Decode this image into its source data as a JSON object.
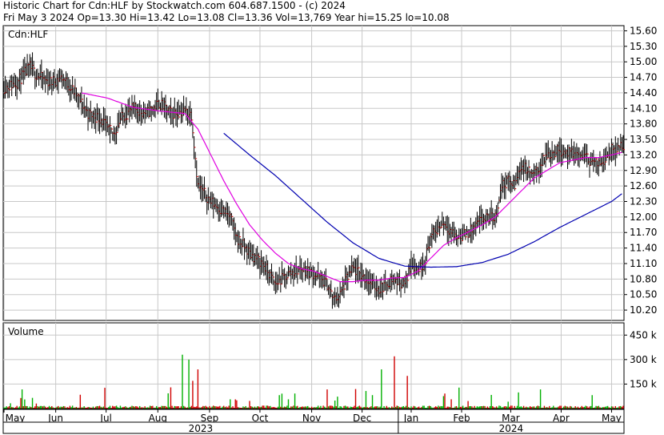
{
  "header": {
    "line1": "Historic Chart for Cdn:HLF by Stockwatch.com 604.687.1500 - (c) 2024",
    "line2": "Fri May  3 2024   Op=13.30   Hi=13.42   Lo=13.08   Cl=13.36   Vol=13,769   Year hi=15.25   lo=10.08"
  },
  "symbol_label": "Cdn:HLF",
  "volume_label": "Volume",
  "colors": {
    "candle": "#000000",
    "close_tick": "#cc0000",
    "ma_short": "#e000e0",
    "ma_long": "#0000b0",
    "vol_up": "#00b000",
    "vol_down": "#d00000",
    "grid": "#c8c8c8",
    "frame": "#000000"
  },
  "chart_data": [
    {
      "type": "line",
      "title": "Cdn:HLF",
      "ylim": [
        10.0,
        15.7
      ],
      "y_ticks": [
        "15.60",
        "15.30",
        "15.00",
        "14.70",
        "14.40",
        "14.10",
        "13.80",
        "13.50",
        "13.20",
        "12.90",
        "12.60",
        "12.30",
        "12.00",
        "11.70",
        "11.40",
        "11.10",
        "10.80",
        "10.50",
        "10.20"
      ],
      "x_ticks": [
        "May",
        "Jun",
        "Jul",
        "Aug",
        "Sep",
        "Oct",
        "Nov",
        "Dec",
        "Jan",
        "Feb",
        "Mar",
        "Apr",
        "May"
      ],
      "year_labels": [
        "2023",
        "2024"
      ],
      "grid": true,
      "series": [
        {
          "name": "price_close",
          "anchors": [
            [
              0,
              14.5
            ],
            [
              10,
              14.6
            ],
            [
              20,
              14.9
            ],
            [
              25,
              14.75
            ],
            [
              35,
              14.6
            ],
            [
              45,
              14.7
            ],
            [
              55,
              14.4
            ],
            [
              65,
              14.0
            ],
            [
              75,
              13.9
            ],
            [
              80,
              13.7
            ],
            [
              85,
              13.6
            ],
            [
              90,
              13.9
            ],
            [
              100,
              14.1
            ],
            [
              110,
              14.0
            ],
            [
              120,
              14.2
            ],
            [
              130,
              14.0
            ],
            [
              140,
              14.05
            ],
            [
              145,
              13.98
            ],
            [
              150,
              12.6
            ],
            [
              160,
              12.3
            ],
            [
              170,
              12.1
            ],
            [
              175,
              12.0
            ],
            [
              180,
              11.6
            ],
            [
              190,
              11.3
            ],
            [
              200,
              11.1
            ],
            [
              210,
              10.7
            ],
            [
              220,
              10.9
            ],
            [
              230,
              11.0
            ],
            [
              240,
              10.9
            ],
            [
              250,
              10.7
            ],
            [
              255,
              10.4
            ],
            [
              260,
              10.5
            ],
            [
              265,
              10.8
            ],
            [
              270,
              11.0
            ],
            [
              280,
              10.8
            ],
            [
              290,
              10.6
            ],
            [
              300,
              10.8
            ],
            [
              310,
              10.7
            ],
            [
              315,
              11.1
            ],
            [
              320,
              11.0
            ],
            [
              325,
              11.1
            ],
            [
              330,
              11.6
            ],
            [
              340,
              11.9
            ],
            [
              350,
              11.6
            ],
            [
              360,
              11.7
            ],
            [
              370,
              11.95
            ],
            [
              380,
              12.0
            ],
            [
              385,
              12.6
            ],
            [
              390,
              12.7
            ],
            [
              395,
              12.6
            ],
            [
              400,
              13.0
            ],
            [
              410,
              12.8
            ],
            [
              420,
              13.2
            ],
            [
              430,
              13.3
            ],
            [
              440,
              13.2
            ],
            [
              450,
              13.15
            ],
            [
              460,
              13.0
            ],
            [
              470,
              13.3
            ],
            [
              478,
              13.36
            ]
          ]
        },
        {
          "name": "ma_short",
          "anchors": [
            [
              60,
              14.4
            ],
            [
              80,
              14.3
            ],
            [
              100,
              14.12
            ],
            [
              120,
              14.05
            ],
            [
              140,
              14.0
            ],
            [
              150,
              13.7
            ],
            [
              160,
              13.2
            ],
            [
              170,
              12.7
            ],
            [
              180,
              12.25
            ],
            [
              190,
              11.85
            ],
            [
              200,
              11.55
            ],
            [
              210,
              11.3
            ],
            [
              220,
              11.1
            ],
            [
              230,
              11.0
            ],
            [
              240,
              10.95
            ],
            [
              250,
              10.85
            ],
            [
              260,
              10.75
            ],
            [
              270,
              10.75
            ],
            [
              280,
              10.78
            ],
            [
              290,
              10.78
            ],
            [
              300,
              10.82
            ],
            [
              310,
              10.83
            ],
            [
              320,
              10.95
            ],
            [
              330,
              11.2
            ],
            [
              340,
              11.45
            ],
            [
              350,
              11.6
            ],
            [
              360,
              11.72
            ],
            [
              370,
              11.85
            ],
            [
              380,
              12.0
            ],
            [
              390,
              12.25
            ],
            [
              400,
              12.5
            ],
            [
              410,
              12.75
            ],
            [
              420,
              12.9
            ],
            [
              430,
              13.05
            ],
            [
              440,
              13.1
            ],
            [
              450,
              13.15
            ],
            [
              460,
              13.15
            ],
            [
              470,
              13.2
            ],
            [
              478,
              13.25
            ]
          ]
        },
        {
          "name": "ma_long",
          "anchors": [
            [
              170,
              13.62
            ],
            [
              190,
              13.2
            ],
            [
              210,
              12.8
            ],
            [
              230,
              12.35
            ],
            [
              250,
              11.9
            ],
            [
              270,
              11.5
            ],
            [
              290,
              11.2
            ],
            [
              310,
              11.05
            ],
            [
              330,
              11.03
            ],
            [
              350,
              11.04
            ],
            [
              370,
              11.12
            ],
            [
              390,
              11.28
            ],
            [
              410,
              11.52
            ],
            [
              430,
              11.8
            ],
            [
              450,
              12.05
            ],
            [
              470,
              12.3
            ],
            [
              478,
              12.45
            ]
          ]
        }
      ]
    },
    {
      "type": "bar",
      "title": "Volume",
      "y_ticks": [
        "450 k",
        "300 k",
        "150 k"
      ],
      "ylim": [
        0,
        525000
      ],
      "spikes": [
        [
          138,
          330000
        ],
        [
          143,
          300000
        ],
        [
          146,
          170000
        ],
        [
          150,
          240000
        ],
        [
          292,
          240000
        ],
        [
          302,
          320000
        ],
        [
          312,
          200000
        ]
      ]
    }
  ]
}
